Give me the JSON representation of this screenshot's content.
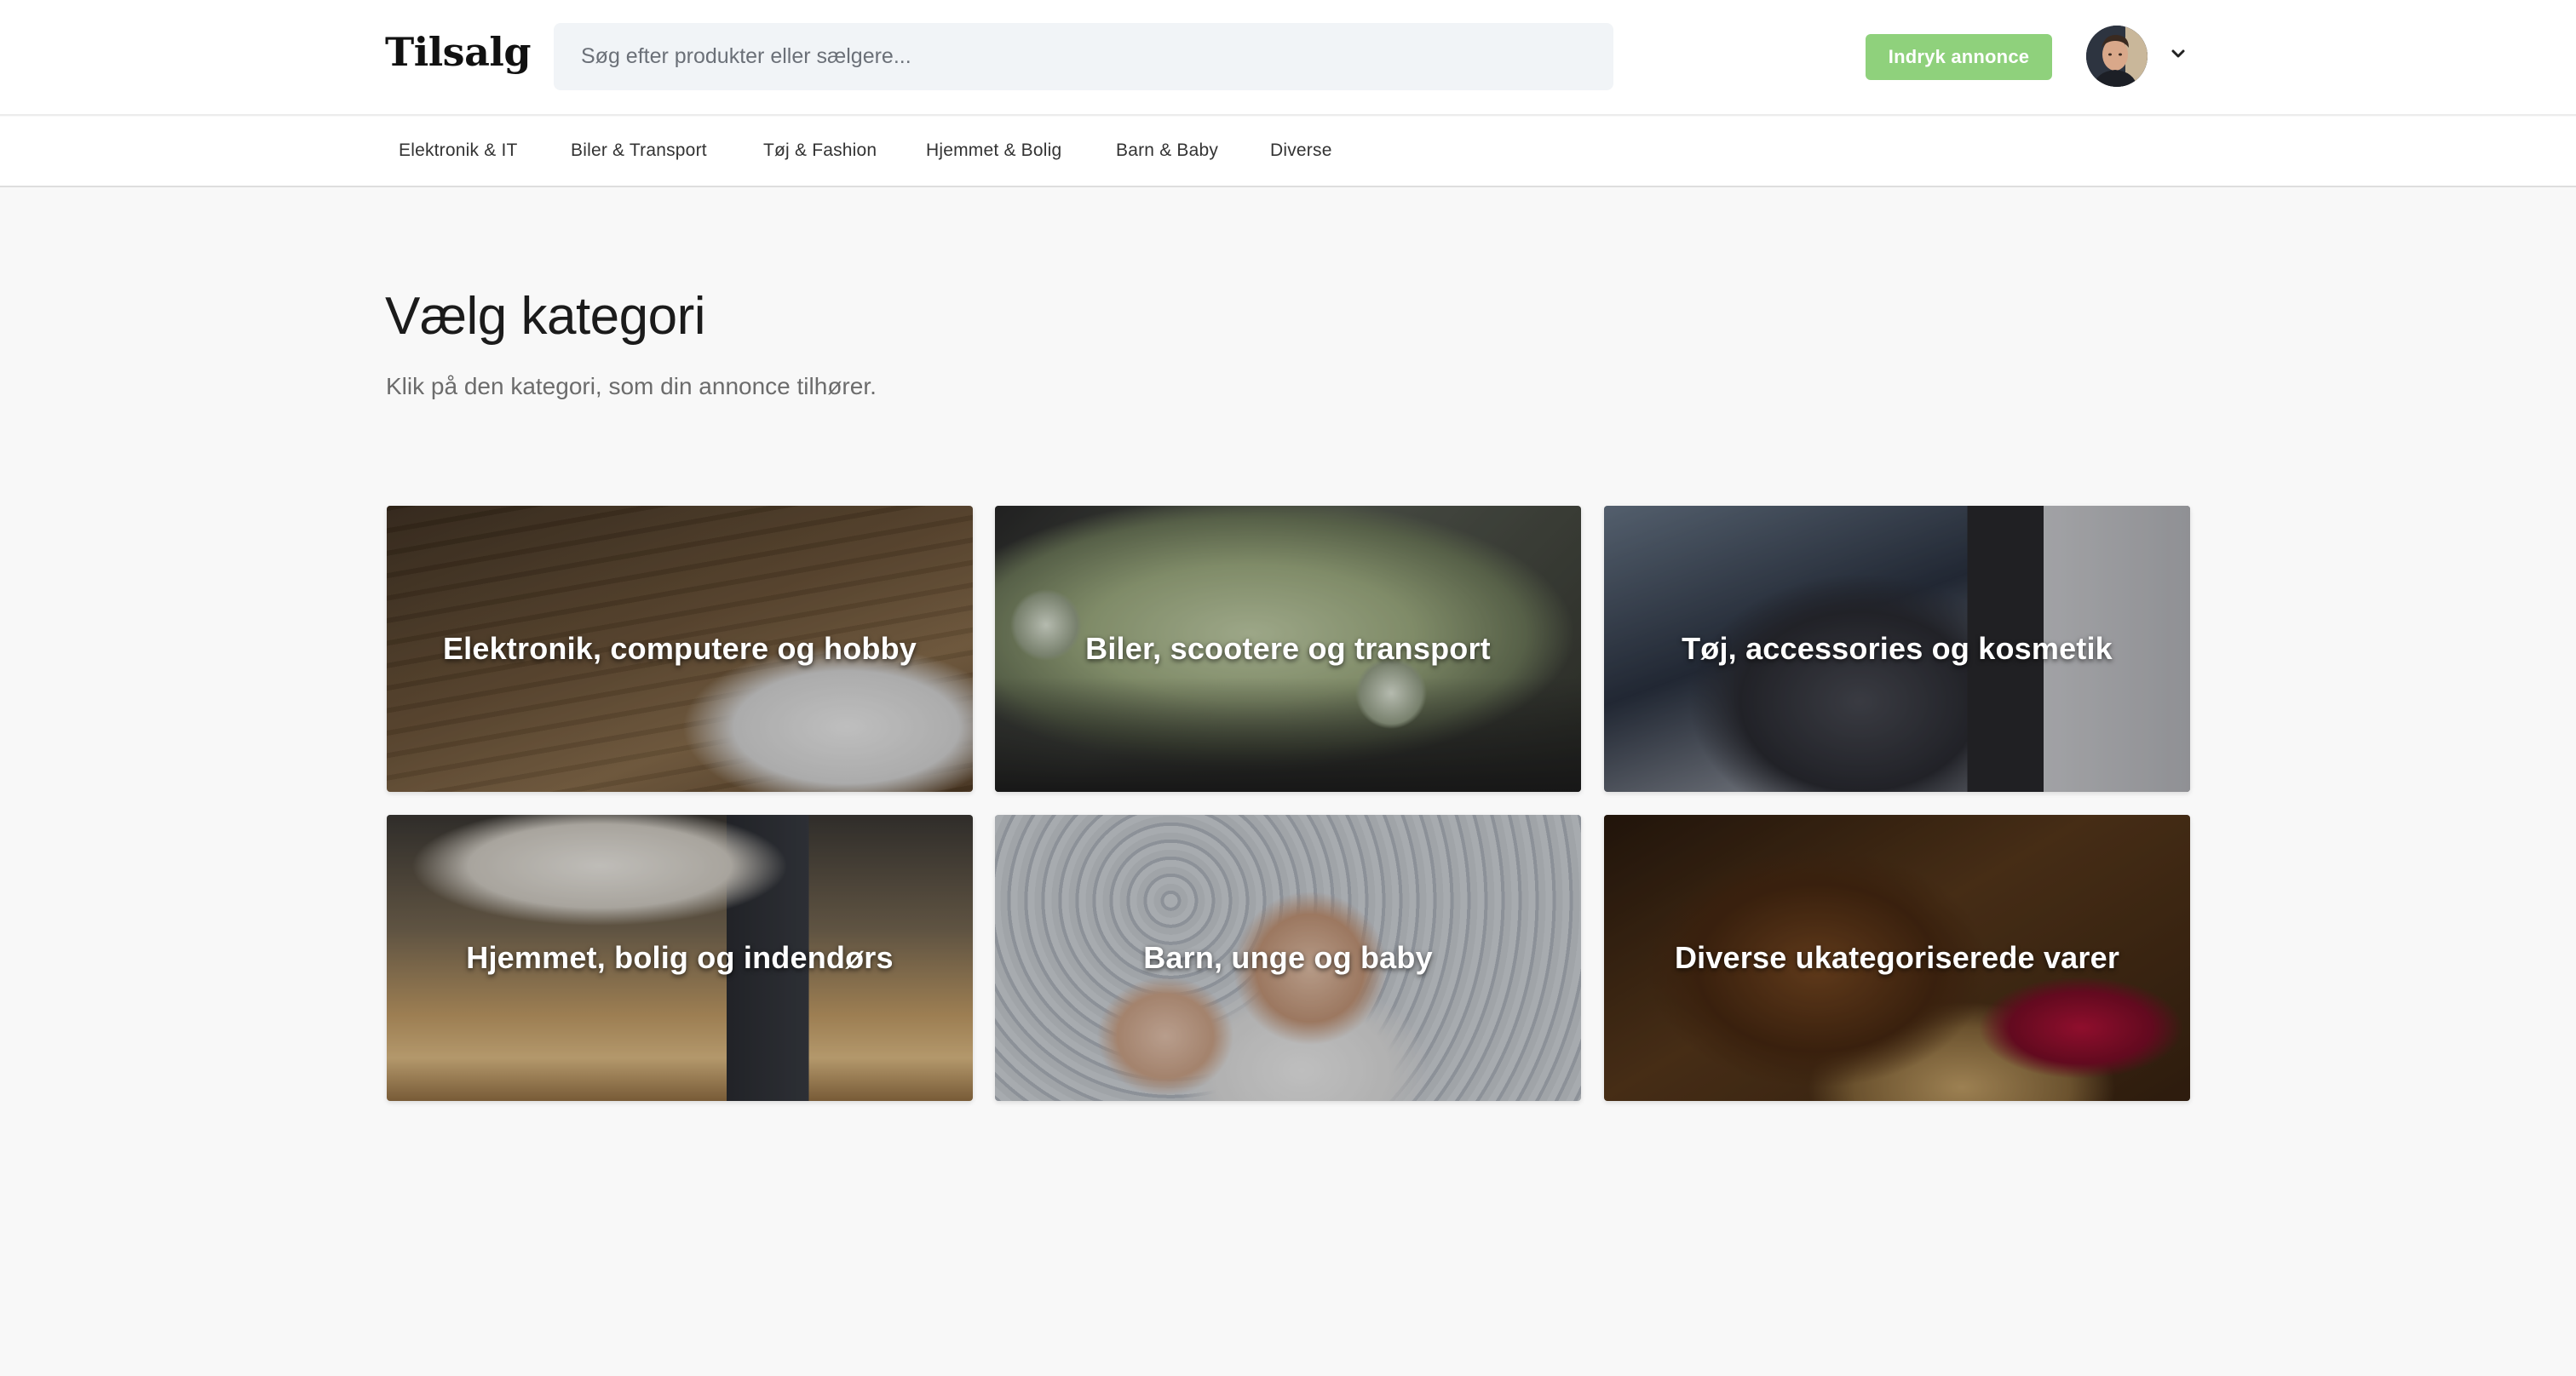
{
  "header": {
    "logo": "Tilsalg",
    "search_placeholder": "Søg efter produkter eller sælgere...",
    "cta_label": "Indryk annonce",
    "avatar_icon": "user-avatar",
    "menu_icon": "chevron-down-icon",
    "accent_color": "#8fd17c"
  },
  "nav": {
    "items": [
      {
        "label": "Elektronik & IT"
      },
      {
        "label": "Biler & Transport"
      },
      {
        "label": "Tøj & Fashion"
      },
      {
        "label": "Hjemmet & Bolig"
      },
      {
        "label": "Barn & Baby"
      },
      {
        "label": "Diverse"
      }
    ]
  },
  "main": {
    "title": "Vælg kategori",
    "subtitle": "Klik på den kategori, som din annonce tilhører.",
    "categories": [
      {
        "label": "Elektronik, computere og hobby"
      },
      {
        "label": "Biler, scootere og transport"
      },
      {
        "label": "Tøj, accessories og kosmetik"
      },
      {
        "label": "Hjemmet, bolig og indendørs"
      },
      {
        "label": "Barn, unge og baby"
      },
      {
        "label": "Diverse ukategoriserede varer"
      }
    ]
  }
}
